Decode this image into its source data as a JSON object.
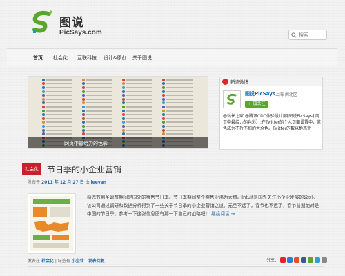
{
  "site": {
    "title": "图说",
    "subtitle": "PicSays.com"
  },
  "search": {
    "placeholder": "搜索"
  },
  "nav": {
    "items": [
      {
        "label": "首页",
        "active": true
      },
      {
        "label": "社会化"
      },
      {
        "label": "互联科技"
      },
      {
        "label": "设计&原创"
      },
      {
        "label": "关于图说"
      }
    ]
  },
  "slider": {
    "caption": "网页中最给力的色彩"
  },
  "weibo": {
    "header": "新浪微博",
    "profile_name": "图说PicSays",
    "location": "上海 闸北区",
    "follow_label": "+ 加关注",
    "feed_text": "@站长之家 @腾讯CDC体验设计部[图说PicSays] 网页中最给力的色彩】:在Twitter的个人页面设置中，蓝色成为不折不扣的大众色。Twitter的数以静态背"
  },
  "post": {
    "category": "社会化",
    "title": "节日季的小企业营销",
    "meta_prefix": "发表于",
    "date": "2011 年 12 月 27 日",
    "author": "leevan",
    "body": "感恩节到圣诞节期间是国外的零售节日季。节日季期间整个零售业沸为大增。Intuit是国外关注小企业发展的公司。该公司通过调研和数据分析得到了一些关于节日季的小企业营销之道。元旦不远了，春节也不远了，春节前期绝对是中国的节日季。参考一下这张信息图有那一下自己的战略吧！",
    "read_more": "继续阅读 →",
    "footer_prefix": "发表在",
    "footer_cat": "社会化",
    "footer_sep": "| 标签有",
    "footer_tag1": "小企业",
    "footer_tag2": "发表回复",
    "share_label": "分享："
  }
}
